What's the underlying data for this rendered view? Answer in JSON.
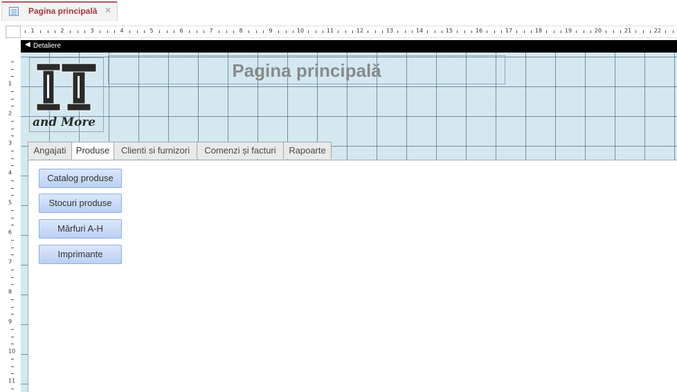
{
  "document_tab": {
    "title": "Pagina principală",
    "icon": "form-icon",
    "close_glyph": "✕"
  },
  "ruler": {
    "horizontal_numbers": [
      "1",
      "2",
      "3",
      "4",
      "5",
      "6",
      "7",
      "8",
      "9",
      "10",
      "11",
      "12",
      "13",
      "14",
      "15",
      "16",
      "17",
      "18",
      "19",
      "20",
      "21",
      "22"
    ],
    "vertical_numbers": [
      "1",
      "2",
      "3",
      "4",
      "5",
      "6",
      "7",
      "8",
      "9",
      "10",
      "11"
    ]
  },
  "section": {
    "label": "Detaliere"
  },
  "form": {
    "title": "Pagina principală",
    "logo": {
      "line1": "IT",
      "line2": "and More"
    },
    "tabs": [
      {
        "label": "Angajati",
        "active": false
      },
      {
        "label": "Produse",
        "active": true
      },
      {
        "label": "Clienti si furnizori",
        "active": false
      },
      {
        "label": "Comenzi și facturi",
        "active": false
      },
      {
        "label": "Rapoarte",
        "active": false
      }
    ],
    "buttons": [
      {
        "label": "Catalog produse"
      },
      {
        "label": "Stocuri produse"
      },
      {
        "label": "Mărfuri A-H"
      },
      {
        "label": "Imprimante"
      }
    ]
  },
  "colors": {
    "canvas": "#d4e8f0",
    "tab_accent": "#c55a6a",
    "button_fill": "#bcd0f3"
  }
}
